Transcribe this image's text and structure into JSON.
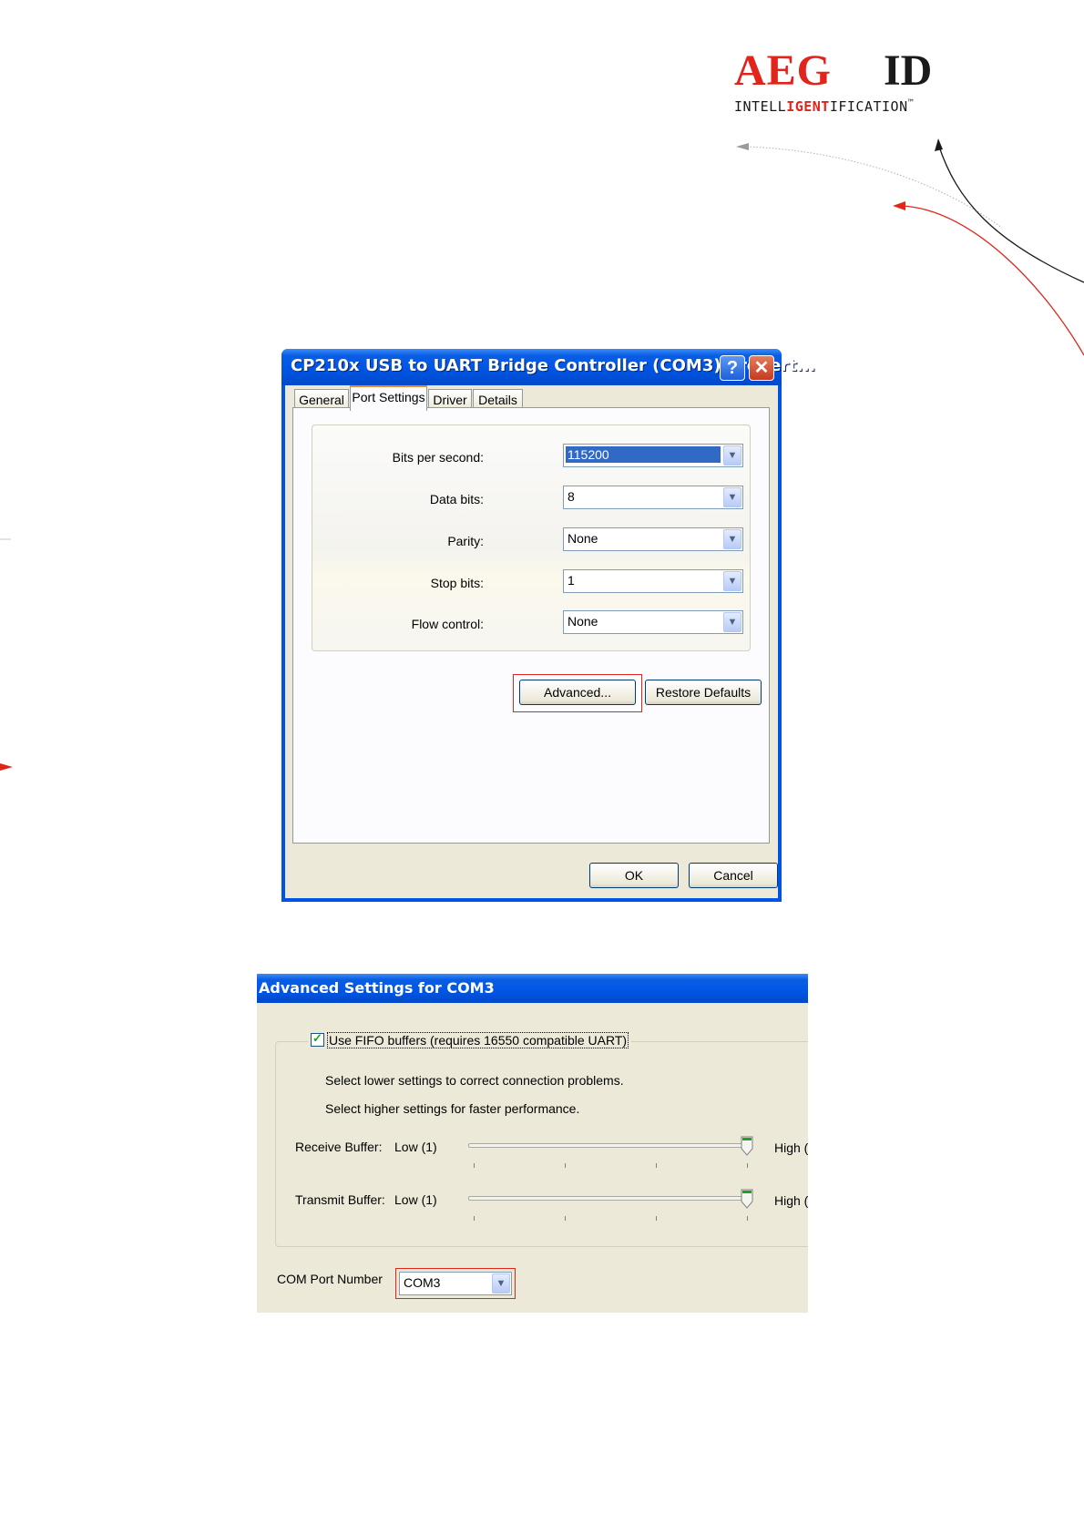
{
  "logo": {
    "brand": "AEG",
    "id": "ID",
    "tagline_pre": "INTELL",
    "tagline_hl": "IGENT",
    "tagline_post": "IFICATION",
    "tm": "™"
  },
  "properties_dialog": {
    "title": "CP210x USB to UART Bridge Controller (COM3) Propert...",
    "help_glyph": "?",
    "close_glyph": "✕",
    "tabs": [
      "General",
      "Port Settings",
      "Driver",
      "Details"
    ],
    "active_tab": "Port Settings",
    "fields": [
      {
        "label": "Bits per second:",
        "value": "115200"
      },
      {
        "label": "Data bits:",
        "value": "8"
      },
      {
        "label": "Parity:",
        "value": "None"
      },
      {
        "label": "Stop bits:",
        "value": "1"
      },
      {
        "label": "Flow control:",
        "value": "None"
      }
    ],
    "advanced_button": "Advanced...",
    "restore_button": "Restore Defaults",
    "ok_button": "OK",
    "cancel_button": "Cancel"
  },
  "advanced_dialog": {
    "title": "Advanced Settings for COM3",
    "fifo_label": "Use FIFO buffers (requires 16550 compatible UART)",
    "fifo_checked": true,
    "hint_lower": "Select lower settings to correct connection problems.",
    "hint_higher": "Select higher settings for faster performance.",
    "receive": {
      "label": "Receive Buffer:",
      "low": "Low (1)",
      "high": "High (",
      "level_fraction": 1.0
    },
    "transmit": {
      "label": "Transmit Buffer:",
      "low": "Low (1)",
      "high": "High (",
      "level_fraction": 1.0
    },
    "com_port_label": "COM Port Number",
    "com_port_value": "COM3"
  },
  "colors": {
    "brand_red": "#e1251b",
    "xp_blue": "#0055e5",
    "dialog_face": "#ece9d8"
  },
  "icons": [
    "help-icon",
    "close-icon",
    "dropdown-arrow-icon",
    "checkmark-icon",
    "slider-thumb-icon"
  ]
}
